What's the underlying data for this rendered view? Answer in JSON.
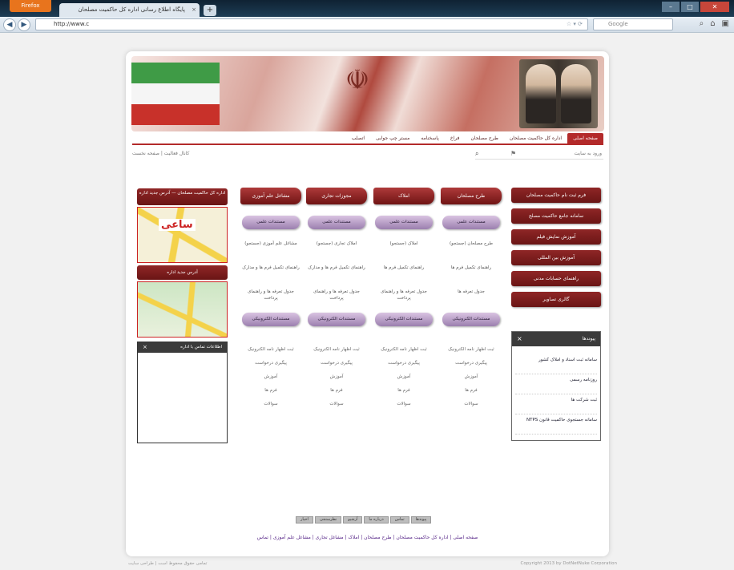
{
  "browser": {
    "app_button": "Firefox",
    "tab_title": "پایگاه اطلاع رسانی اداره کل حاکمیت مصلحان",
    "tab_close": "×",
    "new_tab": "+",
    "url": "http://www.c",
    "search_placeholder": "Google"
  },
  "menu": [
    "صفحه اصلی",
    "اداره کل حاکمیت مصلحان",
    "طرح مصلحان",
    "فراخ",
    "پاسخنامه",
    "مستر چپ جوابی",
    "اتصلب"
  ],
  "search": {
    "text": "ورود به سایت"
  },
  "breadcrumb": "کانال فعالیت | صفحه نخست",
  "right_buttons": [
    "فرم ثبت نام حاکمیت مصلحان",
    "سامانه جامع حاکمیت مصلح",
    "آموزش نمایش فیلم",
    "آموزش بین المللی",
    "راهنمای حسابات مدنی",
    "گالری تصاویر"
  ],
  "news": {
    "title": "پیوندها",
    "close": "×",
    "items": [
      "سامانه ثبت اسناد و املاک کشور",
      "روزنامه رسمی",
      "ثبت شرکت ها",
      "سامانه جستجوی حاکمیت قانون NTPS"
    ]
  },
  "columns": [
    {
      "head": "طرح مصلحان",
      "pill1": "مستندات علمی",
      "item1": "طرح مصلحان (جستجو)",
      "item2": "راهنمای تکمیل فرم ها",
      "item3": "جدول تعرفه ها",
      "pill2": "مستندات الکترونیکی"
    },
    {
      "head": "املاک",
      "pill1": "مستندات علمی",
      "item1": "املاک (جستجو)",
      "item2": "راهنمای تکمیل فرم ها",
      "item3": "جدول تعرفه ها و راهنمای پرداخت",
      "pill2": "مستندات الکترونیکی"
    },
    {
      "head": "مجوزات تجاری",
      "pill1": "مستندات علمی",
      "item1": "املاک تجاری (جستجو)",
      "item2": "راهنمای تکمیل فرم ها و مدارک",
      "item3": "جدول تعرفه ها و راهنمای پرداخت",
      "pill2": "مستندات الکترونیکی"
    },
    {
      "head": "مشاغل علم آموزی",
      "pill1": "مستندات علمی",
      "item1": "مشاغل علم آموزی (جستجو)",
      "item2": "راهنمای تکمیل فرم ها و مدارک",
      "item3": "جدول تعرفه ها و راهنمای پرداخت",
      "pill2": "مستندات الکترونیکی"
    }
  ],
  "column_links": [
    "ثبت اظهار نامه الکترونیک",
    "پیگیری درخواست",
    "آموزش",
    "فرم ها",
    "سوالات"
  ],
  "left": {
    "header": "اداره کل حاکمیت مصلحان — آدرس جدید اداره",
    "map1_label": "ساعی",
    "mid_header": "آدرس جدید اداره",
    "panel_title": "اطلاعات تماس با اداره",
    "panel_close": "×"
  },
  "footer_buttons": [
    "پیوندها",
    "تماس",
    "درباره ما",
    "آرشیو",
    "نظرسنجی",
    "اخبار"
  ],
  "footer_links": "صفحه اصلی | اداره کل حاکمیت مصلحان | طرح مصلحان | املاک | مشاغل تجاری | مشاغل علم آموزی | تماس",
  "bottom_left": "تمامی حقوق محفوظ است | طراحی سایت",
  "bottom_right": "Copyright 2013 by DotNetNuke Corporation"
}
